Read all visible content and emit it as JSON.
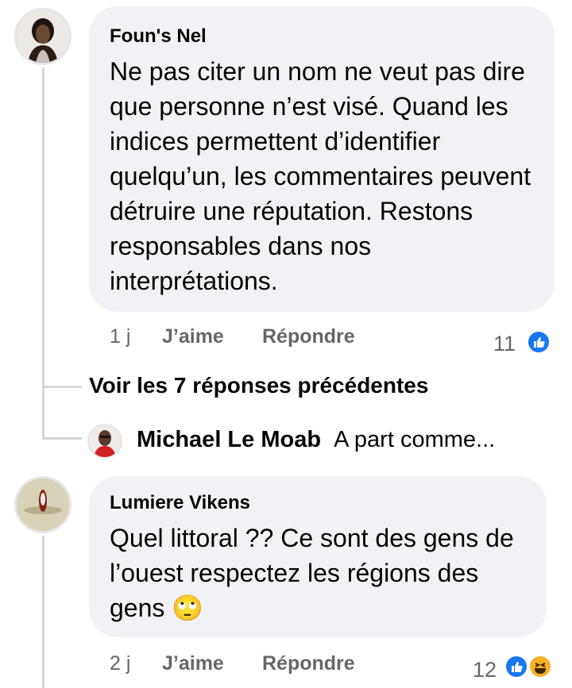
{
  "comments": [
    {
      "author": "Foun's Nel",
      "text": "Ne pas citer un nom ne veut pas dire que personne n’est visé. Quand les indices permettent d’identifier quelqu’un, les commentaires peuvent détruire une réputation. Restons responsables dans nos interprétations.",
      "time": "1 j",
      "like_label": "J’aime",
      "reply_label": "Répondre",
      "reaction_count": "11"
    },
    {
      "author": "Lumiere Vikens",
      "text": "Quel littoral ?? Ce sont des gens de l’ouest respectez les régions des gens",
      "emoji": "🙄",
      "time": "2 j",
      "like_label": "J’aime",
      "reply_label": "Répondre",
      "reaction_count": "12"
    }
  ],
  "view_previous_replies": "Voir les 7 réponses précédentes",
  "reply_preview": {
    "author": "Michael Le Moab",
    "text": "A part comme..."
  },
  "colors": {
    "bubble": "#f0f2f5",
    "meta": "#65676b",
    "like_blue": "#1877f2",
    "haha_yellow": "#f7b125"
  }
}
